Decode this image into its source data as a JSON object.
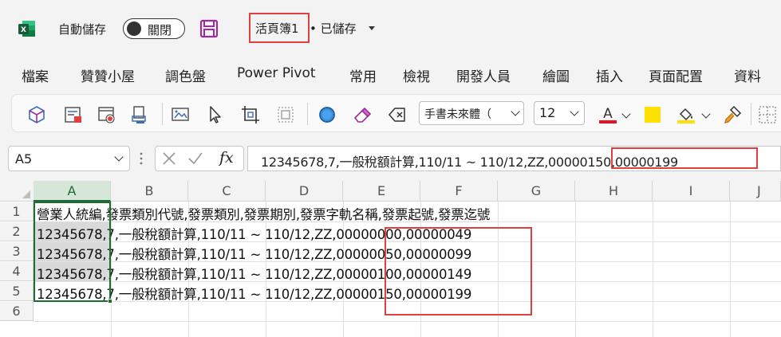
{
  "titlebar": {
    "autosave_label": "自動儲存",
    "toggle_state": "關閉",
    "doc_name": "活頁簿1",
    "doc_status": "• 已儲存"
  },
  "ribbon_tabs": [
    "檔案",
    "贊贊小屋",
    "調色盤",
    "Power Pivot",
    "常用",
    "檢視",
    "開發人員",
    "繪圖",
    "插入",
    "頁面配置",
    "資料"
  ],
  "toolbar": {
    "font_name": "手書未來體（",
    "font_size": "12",
    "font_color": "#e81123",
    "highlight_color": "#ffe000",
    "icons": [
      "3d-model-icon",
      "form-icon",
      "record-macro-icon",
      "screen-reader-icon",
      "screenshot-icon",
      "select-pointer-icon",
      "crop-icon",
      "select-objects-icon",
      "circle-icon",
      "eraser-icon",
      "clear-format-icon",
      "font-color-icon",
      "highlight-icon",
      "fill-color-icon",
      "format-painter-icon",
      "borders-icon"
    ]
  },
  "formula_bar": {
    "name_box": "A5",
    "fx_label": "fx",
    "formula": "12345678,7,一般稅額計算,110/11 ~ 110/12,ZZ,00000150,00000199"
  },
  "grid": {
    "columns": [
      "A",
      "B",
      "C",
      "D",
      "E",
      "F",
      "G",
      "H",
      "I",
      "J"
    ],
    "selected_column": "A",
    "rows": [
      "1",
      "2",
      "3",
      "4",
      "5",
      "6"
    ],
    "cells": [
      "營業人統編,發票類別代號,發票類別,發票期別,發票字軌名稱,發票起號,發票迄號",
      "12345678,7,一般稅額計算,110/11 ~ 110/12,ZZ,00000000,00000049",
      "12345678,7,一般稅額計算,110/11 ~ 110/12,ZZ,00000050,00000099",
      "12345678,7,一般稅額計算,110/11 ~ 110/12,ZZ,00000100,00000149",
      "12345678,7,一般稅額計算,110/11 ~ 110/12,ZZ,00000150,00000199",
      ""
    ]
  },
  "colors": {
    "accent_green": "#1e6b35",
    "highlight_red": "#e0413f",
    "save_purple": "#9b2e96"
  }
}
